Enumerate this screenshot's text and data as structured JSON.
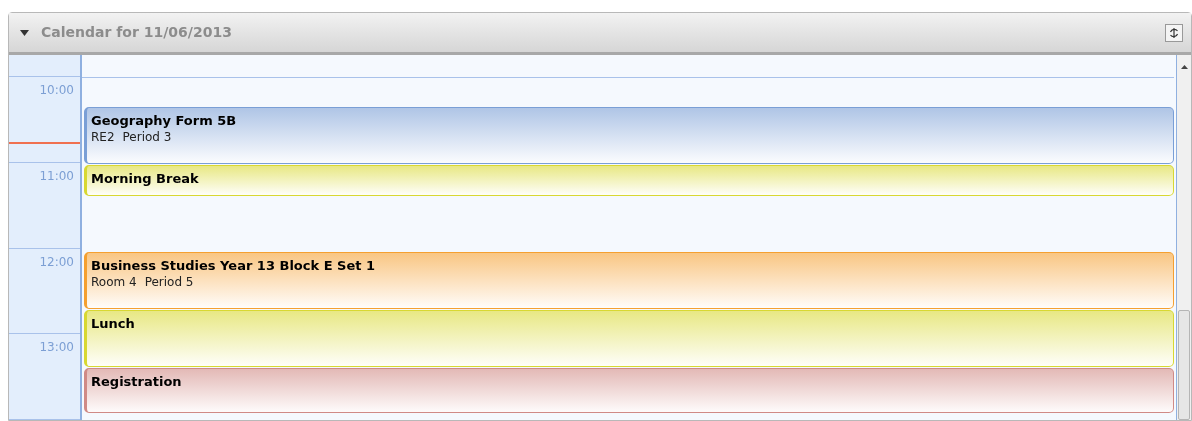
{
  "panel": {
    "title": "Calendar for 11/06/2013",
    "expanded": true
  },
  "time_slots": [
    "10:00",
    "11:00",
    "12:00",
    "13:00"
  ],
  "events": [
    {
      "title": "Geography Form 5B",
      "details": [
        "RE2",
        "Period 3"
      ],
      "color": "#7a9fd6"
    },
    {
      "title": "Morning Break",
      "color": "#d8d832"
    },
    {
      "title": "Business Studies Year 13 Block E Set 1",
      "details": [
        "Room 4",
        "Period 5"
      ],
      "color": "#f5a030"
    },
    {
      "title": "Lunch",
      "color": "#d8d832"
    },
    {
      "title": "Registration",
      "color": "#d08a86"
    }
  ]
}
